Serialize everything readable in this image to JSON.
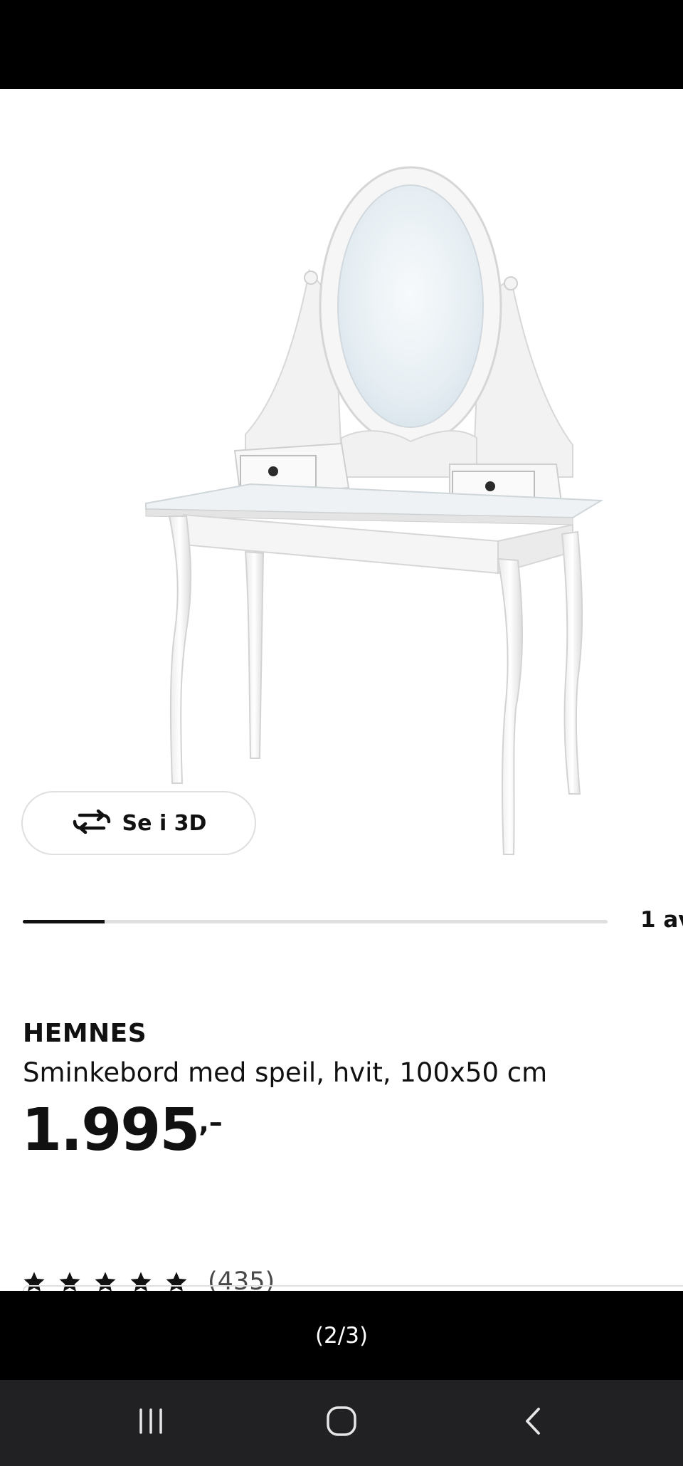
{
  "product": {
    "view_3d_label": "Se i 3D",
    "image_counter": "1 av",
    "image_progress_fraction": 0.14,
    "brand": "HEMNES",
    "description": "Sminkebord med speil, hvit, 100x50 cm",
    "price_integer": "1.995",
    "price_decimal": ",–",
    "rating_stars": 5,
    "review_count": "(435)"
  },
  "viewer": {
    "caption": "(2/3)"
  },
  "icons": {
    "rotate": "rotate-3d-icon",
    "star": "star-icon",
    "recents": "recent-apps-icon",
    "home": "home-icon",
    "back": "back-icon"
  },
  "colors": {
    "text": "#111111",
    "track": "#dfdfdf",
    "navbar": "#212124"
  }
}
